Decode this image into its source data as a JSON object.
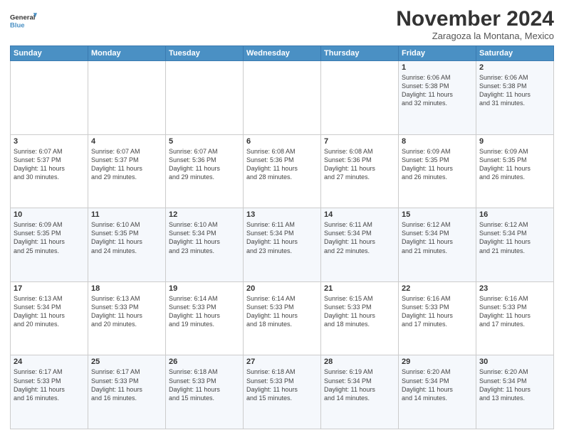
{
  "header": {
    "logo_line1": "General",
    "logo_line2": "Blue",
    "month_title": "November 2024",
    "subtitle": "Zaragoza la Montana, Mexico"
  },
  "weekdays": [
    "Sunday",
    "Monday",
    "Tuesday",
    "Wednesday",
    "Thursday",
    "Friday",
    "Saturday"
  ],
  "weeks": [
    [
      {
        "day": "",
        "info": ""
      },
      {
        "day": "",
        "info": ""
      },
      {
        "day": "",
        "info": ""
      },
      {
        "day": "",
        "info": ""
      },
      {
        "day": "",
        "info": ""
      },
      {
        "day": "1",
        "info": "Sunrise: 6:06 AM\nSunset: 5:38 PM\nDaylight: 11 hours\nand 32 minutes."
      },
      {
        "day": "2",
        "info": "Sunrise: 6:06 AM\nSunset: 5:38 PM\nDaylight: 11 hours\nand 31 minutes."
      }
    ],
    [
      {
        "day": "3",
        "info": "Sunrise: 6:07 AM\nSunset: 5:37 PM\nDaylight: 11 hours\nand 30 minutes."
      },
      {
        "day": "4",
        "info": "Sunrise: 6:07 AM\nSunset: 5:37 PM\nDaylight: 11 hours\nand 29 minutes."
      },
      {
        "day": "5",
        "info": "Sunrise: 6:07 AM\nSunset: 5:36 PM\nDaylight: 11 hours\nand 29 minutes."
      },
      {
        "day": "6",
        "info": "Sunrise: 6:08 AM\nSunset: 5:36 PM\nDaylight: 11 hours\nand 28 minutes."
      },
      {
        "day": "7",
        "info": "Sunrise: 6:08 AM\nSunset: 5:36 PM\nDaylight: 11 hours\nand 27 minutes."
      },
      {
        "day": "8",
        "info": "Sunrise: 6:09 AM\nSunset: 5:35 PM\nDaylight: 11 hours\nand 26 minutes."
      },
      {
        "day": "9",
        "info": "Sunrise: 6:09 AM\nSunset: 5:35 PM\nDaylight: 11 hours\nand 26 minutes."
      }
    ],
    [
      {
        "day": "10",
        "info": "Sunrise: 6:09 AM\nSunset: 5:35 PM\nDaylight: 11 hours\nand 25 minutes."
      },
      {
        "day": "11",
        "info": "Sunrise: 6:10 AM\nSunset: 5:35 PM\nDaylight: 11 hours\nand 24 minutes."
      },
      {
        "day": "12",
        "info": "Sunrise: 6:10 AM\nSunset: 5:34 PM\nDaylight: 11 hours\nand 23 minutes."
      },
      {
        "day": "13",
        "info": "Sunrise: 6:11 AM\nSunset: 5:34 PM\nDaylight: 11 hours\nand 23 minutes."
      },
      {
        "day": "14",
        "info": "Sunrise: 6:11 AM\nSunset: 5:34 PM\nDaylight: 11 hours\nand 22 minutes."
      },
      {
        "day": "15",
        "info": "Sunrise: 6:12 AM\nSunset: 5:34 PM\nDaylight: 11 hours\nand 21 minutes."
      },
      {
        "day": "16",
        "info": "Sunrise: 6:12 AM\nSunset: 5:34 PM\nDaylight: 11 hours\nand 21 minutes."
      }
    ],
    [
      {
        "day": "17",
        "info": "Sunrise: 6:13 AM\nSunset: 5:34 PM\nDaylight: 11 hours\nand 20 minutes."
      },
      {
        "day": "18",
        "info": "Sunrise: 6:13 AM\nSunset: 5:33 PM\nDaylight: 11 hours\nand 20 minutes."
      },
      {
        "day": "19",
        "info": "Sunrise: 6:14 AM\nSunset: 5:33 PM\nDaylight: 11 hours\nand 19 minutes."
      },
      {
        "day": "20",
        "info": "Sunrise: 6:14 AM\nSunset: 5:33 PM\nDaylight: 11 hours\nand 18 minutes."
      },
      {
        "day": "21",
        "info": "Sunrise: 6:15 AM\nSunset: 5:33 PM\nDaylight: 11 hours\nand 18 minutes."
      },
      {
        "day": "22",
        "info": "Sunrise: 6:16 AM\nSunset: 5:33 PM\nDaylight: 11 hours\nand 17 minutes."
      },
      {
        "day": "23",
        "info": "Sunrise: 6:16 AM\nSunset: 5:33 PM\nDaylight: 11 hours\nand 17 minutes."
      }
    ],
    [
      {
        "day": "24",
        "info": "Sunrise: 6:17 AM\nSunset: 5:33 PM\nDaylight: 11 hours\nand 16 minutes."
      },
      {
        "day": "25",
        "info": "Sunrise: 6:17 AM\nSunset: 5:33 PM\nDaylight: 11 hours\nand 16 minutes."
      },
      {
        "day": "26",
        "info": "Sunrise: 6:18 AM\nSunset: 5:33 PM\nDaylight: 11 hours\nand 15 minutes."
      },
      {
        "day": "27",
        "info": "Sunrise: 6:18 AM\nSunset: 5:33 PM\nDaylight: 11 hours\nand 15 minutes."
      },
      {
        "day": "28",
        "info": "Sunrise: 6:19 AM\nSunset: 5:34 PM\nDaylight: 11 hours\nand 14 minutes."
      },
      {
        "day": "29",
        "info": "Sunrise: 6:20 AM\nSunset: 5:34 PM\nDaylight: 11 hours\nand 14 minutes."
      },
      {
        "day": "30",
        "info": "Sunrise: 6:20 AM\nSunset: 5:34 PM\nDaylight: 11 hours\nand 13 minutes."
      }
    ]
  ]
}
